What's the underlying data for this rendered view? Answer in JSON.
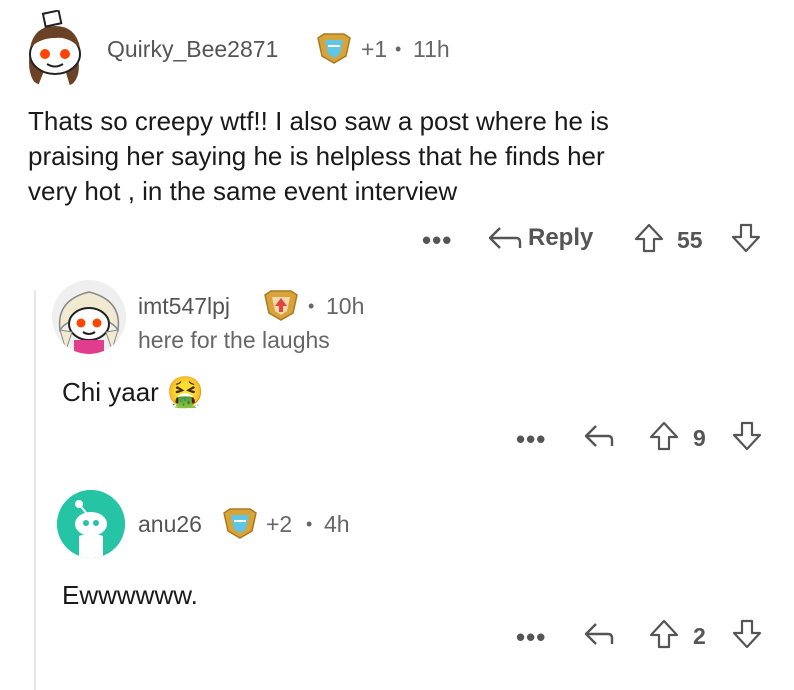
{
  "comments": [
    {
      "username": "Quirky_Bee2871",
      "awards": "+1",
      "separator": "•",
      "time": "11h",
      "text_lines": [
        "Thats so creepy wtf!! I also saw a post where he is",
        "praising her saying he is helpless that he finds her",
        "very hot , in the same event interview"
      ],
      "more": "•••",
      "reply_label": "Reply",
      "score": "55",
      "avatar_icon": "snoo-girl-avatar-icon",
      "award_icon": "award-badge-icon"
    },
    {
      "username": "imt547lpj",
      "separator": "•",
      "time": "10h",
      "flair": "here for the laughs",
      "text": "Chi yaar",
      "emoji": "🤮",
      "more": "•••",
      "score": "9",
      "avatar_icon": "snoo-blonde-avatar-icon",
      "award_icon": "rank-badge-icon"
    },
    {
      "username": "anu26",
      "awards": "+2",
      "separator": "•",
      "time": "4h",
      "text": "Ewwwwww.",
      "more": "•••",
      "score": "2",
      "avatar_icon": "default-snoo-avatar-icon",
      "award_icon": "award-badge-icon"
    }
  ],
  "colors": {
    "avatar_teal": "#25c4a4",
    "award_gold": "#d8a43a",
    "award_blue": "#5ec6e8",
    "rank_red": "#e0473a"
  }
}
